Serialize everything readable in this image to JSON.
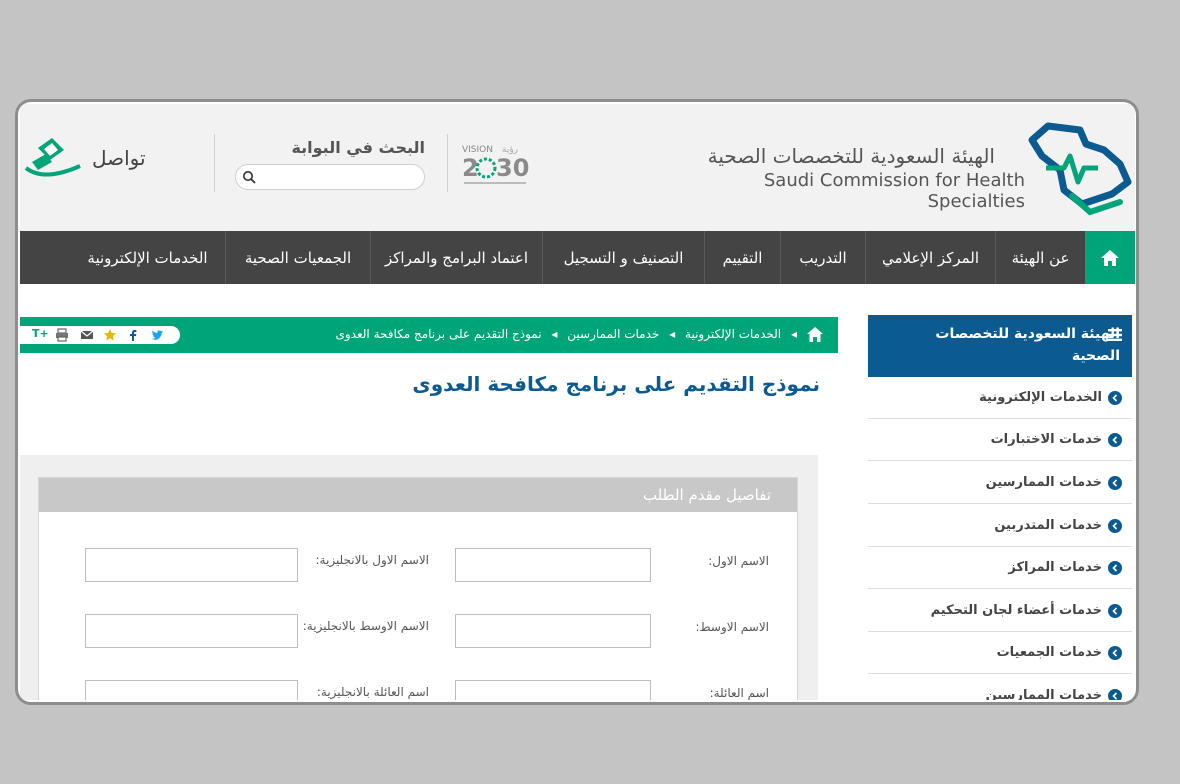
{
  "header": {
    "org_name_ar": "الهيئة السعودية للتخصصات الصحية",
    "org_name_en": "Saudi Commission for Health Specialties",
    "search_label": "البحث في البوابة",
    "search_placeholder": "",
    "tawasol": "تواصل"
  },
  "nav": {
    "items": [
      "عن الهيئة",
      "المركز الإعلامي",
      "التدريب",
      "التقييم",
      "التصنيف و التسجيل",
      "اعتماد البرامج والمراكز",
      "الجمعيات الصحية",
      "الخدمات الإلكترونية"
    ]
  },
  "sidebar": {
    "title": "الهيئة السعودية للتخصصات الصحية",
    "items": [
      "الخدمات الإلكترونية",
      "خدمات الاختبارات",
      "خدمات الممارسين",
      "خدمات المتدربين",
      "خدمات المراكز",
      "خدمات أعضاء لجان التحكيم",
      "خدمات الجمعيات",
      "خدمات الممارسين"
    ]
  },
  "breadcrumb": {
    "items": [
      "الخدمات الإلكترونية",
      "خدمات الممارسين",
      "نموذج التقديم على برنامج مكافحة العدوى"
    ]
  },
  "share": {
    "font_plus": "T+",
    "font_minus": "-"
  },
  "page": {
    "title": "نموذج التقديم على برنامج مكافحة العدوى",
    "panel_title": "تفاصيل مقدم الطلب"
  },
  "form": {
    "first_name_label": "الاسم الاول:",
    "first_name_en_label": "الاسم الاول بالانجليزية:",
    "middle_name_label": "الاسم الاوسط:",
    "middle_name_en_label": "الاسم الاوسط بالانجليزية:",
    "family_name_label": "اسم العائلة:",
    "family_name_en_label": "اسم العائلة بالانجليزية:"
  },
  "colors": {
    "green": "#00a479",
    "blue": "#0b5b91",
    "nav": "#444444"
  }
}
